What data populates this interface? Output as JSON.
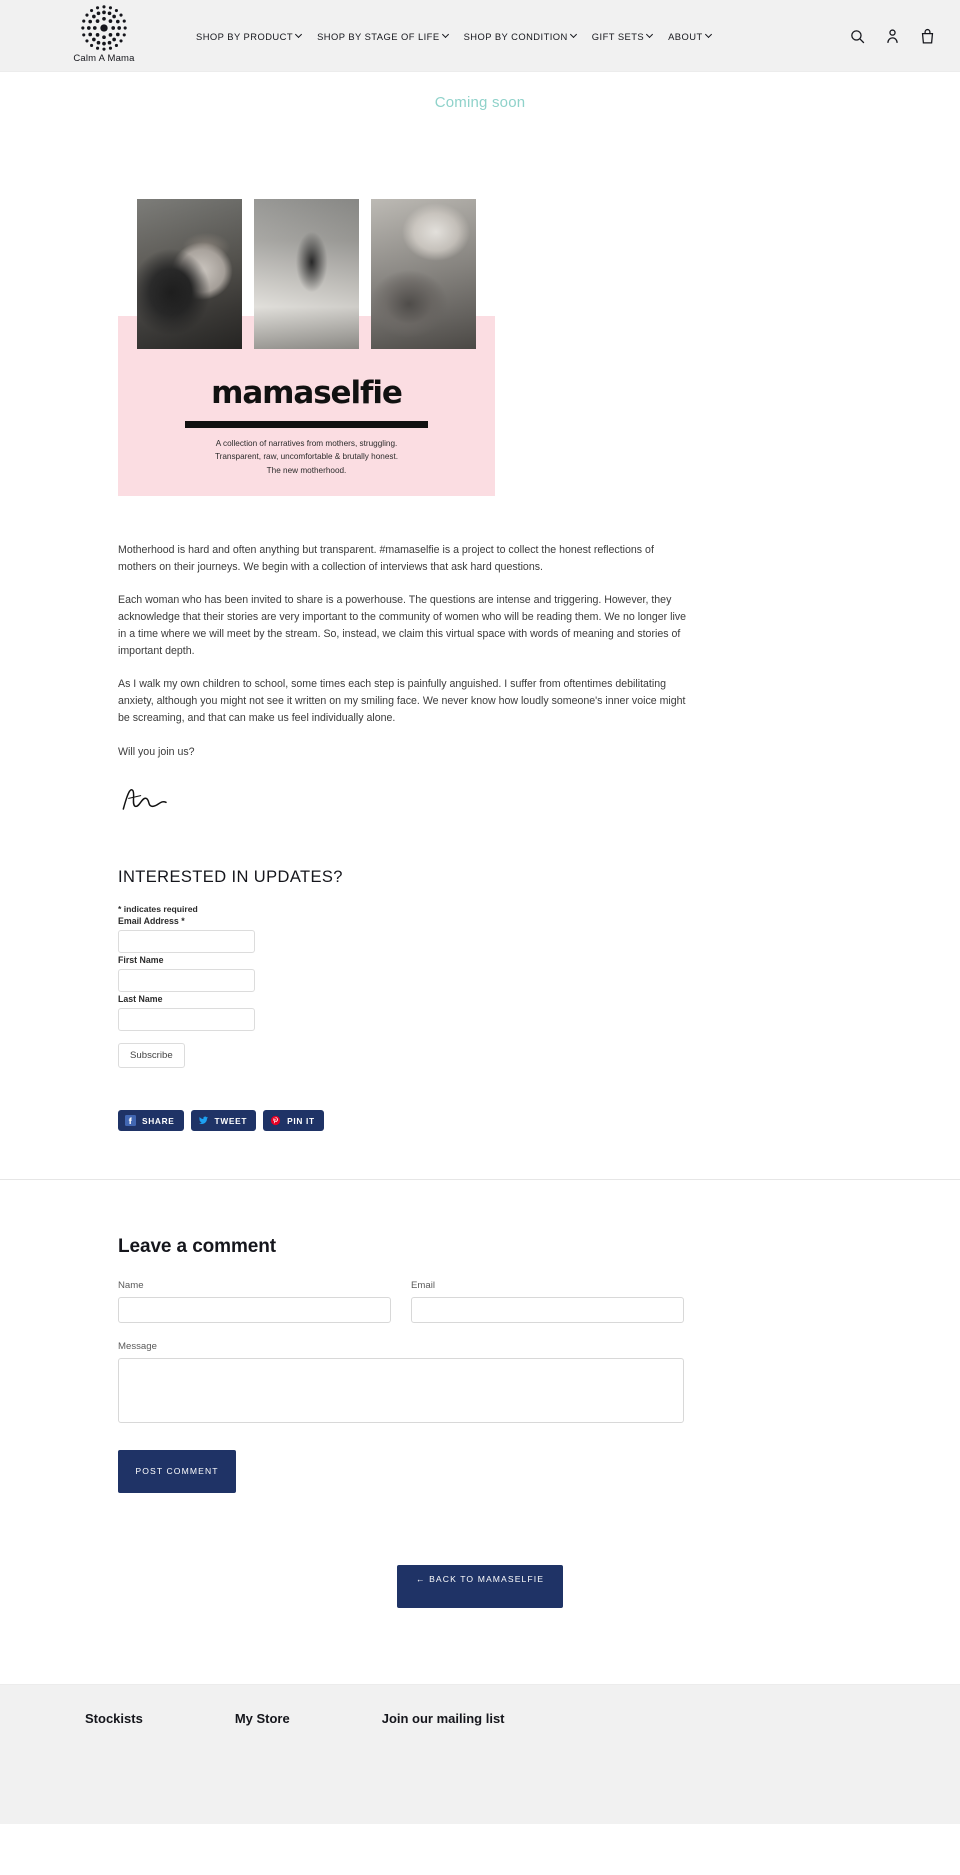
{
  "header": {
    "logo_name": "Calm A Mama",
    "logo_mark": "concentric-dots-logo",
    "nav": [
      {
        "label": "SHOP BY PRODUCT",
        "has_caret": true
      },
      {
        "label": "SHOP BY STAGE OF LIFE",
        "has_caret": true
      },
      {
        "label": "SHOP BY CONDITION",
        "has_caret": true
      },
      {
        "label": "GIFT SETS",
        "has_caret": true
      },
      {
        "label": "ABOUT",
        "has_caret": true
      }
    ],
    "icons": [
      "search-icon",
      "account-icon",
      "cart-icon"
    ]
  },
  "announcement": {
    "text": "Coming soon",
    "color": "#8fd2ca"
  },
  "graphic": {
    "title": "mamaselfie",
    "tagline_line1": "A collection of narratives from mothers, struggling.",
    "tagline_line2": "Transparent, raw, uncomfortable & brutally honest.",
    "tagline_line3": "The new motherhood.",
    "panel_color": "#fbdde2",
    "photo_alts": [
      "mother-kissing-baby-photo",
      "mother-in-hospital-room-photo",
      "sleeping-baby-on-chest-photo"
    ]
  },
  "article": {
    "paragraphs": [
      "Motherhood is hard and often anything but transparent. #mamaselfie is a project to collect the honest reflections of mothers on their journeys.  We begin with a collection of interviews that ask hard questions.",
      "Each woman who has been invited to share is a powerhouse.  The questions are intense and triggering. However, they acknowledge that their stories are very important to the community of women who will be reading them. We no longer live in a time where we will meet by the stream.  So, instead, we claim  this virtual space with words of meaning and stories of important depth.",
      "As I walk my own children to school, some times each step is painfully anguished.  I suffer from oftentimes debilitating anxiety, although you might not see it written on my smiling face.  We never know how loudly someone's inner voice might be screaming, and that can make us feel individually alone.",
      "Will you join us?"
    ]
  },
  "newsletter": {
    "heading": "INTERESTED IN UPDATES?",
    "required_note": "* indicates required",
    "fields": [
      {
        "label": "Email Address *",
        "value": ""
      },
      {
        "label": "First Name",
        "value": ""
      },
      {
        "label": "Last Name",
        "value": ""
      }
    ],
    "submit_label": "Subscribe"
  },
  "share": {
    "buttons": [
      {
        "label": "SHARE",
        "icon": "facebook-icon",
        "icon_color": "#4267b2"
      },
      {
        "label": "TWEET",
        "icon": "twitter-icon",
        "icon_color": "#1da1f2"
      },
      {
        "label": "PIN IT",
        "icon": "pinterest-icon",
        "icon_color": "#e60023"
      }
    ],
    "bg_color": "#1f3366"
  },
  "comment_form": {
    "title": "Leave a comment",
    "name_label": "Name",
    "name_value": "",
    "email_label": "Email",
    "email_value": "",
    "message_label": "Message",
    "message_value": "",
    "submit_label": "POST COMMENT"
  },
  "back": {
    "label": "BACK TO MAMASELFIE",
    "arrow": "←"
  },
  "footer": {
    "columns": [
      {
        "title": "Stockists"
      },
      {
        "title": "My Store"
      },
      {
        "title": "Join our mailing list"
      }
    ]
  }
}
